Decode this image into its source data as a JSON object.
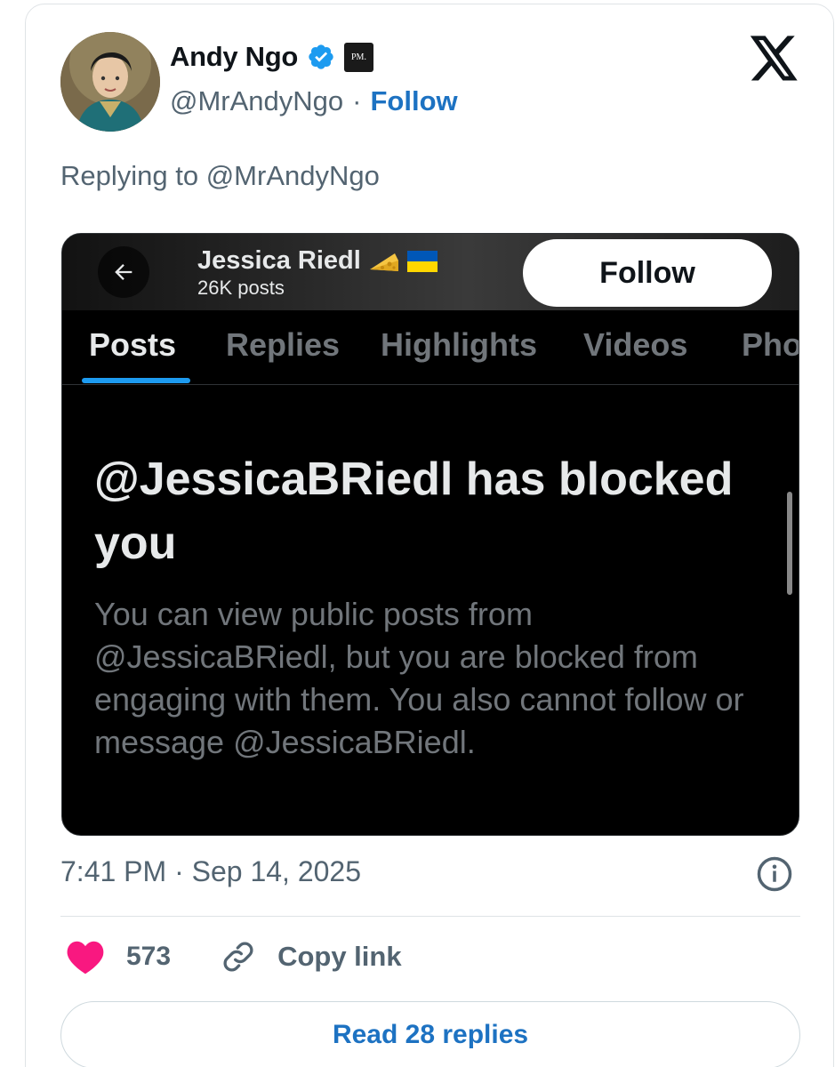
{
  "author": {
    "name": "Andy Ngo",
    "handle": "@MrAndyNgo",
    "separator": "·",
    "follow_label": "Follow",
    "affiliate_badge": "PM."
  },
  "reply": {
    "replying_to": "Replying to @MrAndyNgo"
  },
  "screenshot": {
    "profile_name": "Jessica Riedl",
    "profile_posts": "26K posts",
    "follow_button": "Follow",
    "tabs": [
      "Posts",
      "Replies",
      "Highlights",
      "Videos",
      "Pho"
    ],
    "active_tab": "Posts",
    "blocked_title": "@JessicaBRiedl has blocked you",
    "blocked_body": "You can view public posts from @JessicaBRiedl, but you are blocked from engaging with them. You also cannot follow or message @JessicaBRiedl."
  },
  "meta": {
    "time": "7:41 PM",
    "separator": "·",
    "date": "Sep 14, 2025"
  },
  "actions": {
    "like_count": "573",
    "copy_link_label": "Copy link",
    "read_replies_label": "Read 28 replies"
  },
  "icons": [
    "verified-icon",
    "x-logo-icon",
    "back-arrow-icon",
    "cheese-icon",
    "ukraine-flag-icon",
    "info-icon",
    "heart-icon",
    "link-icon"
  ],
  "colors": {
    "accent": "#1d72c2",
    "verified": "#1d9bf0",
    "like": "#f91880",
    "muted": "#536471"
  }
}
